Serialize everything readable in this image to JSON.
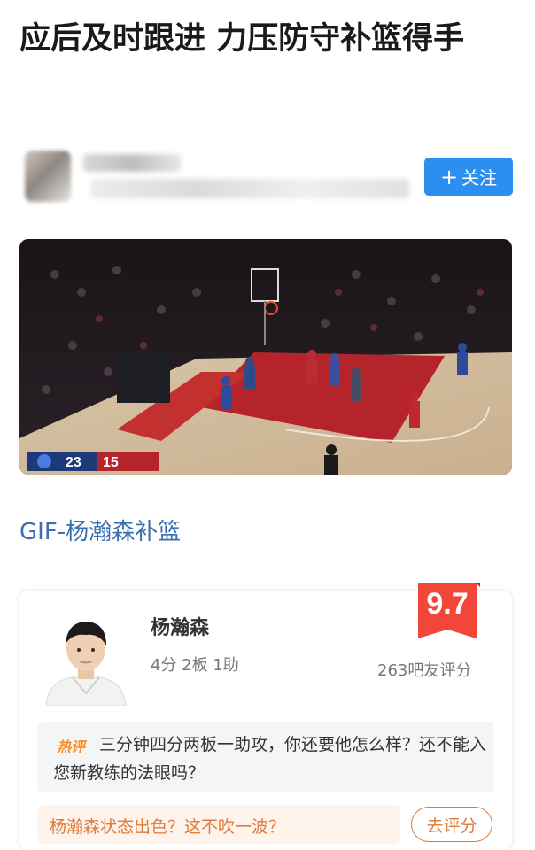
{
  "article": {
    "title": "应后及时跟进 力压防守补篮得手",
    "follow_label": "关注",
    "follow_icon": "plus-icon",
    "video": {
      "scoreboard_left": "23",
      "scoreboard_right": "15"
    },
    "caption": "GIF-杨瀚森补篮"
  },
  "player_card": {
    "name": "杨瀚森",
    "stats": "4分 2板 1助",
    "score": "9.7",
    "rating_count": "263吧友评分",
    "hot_tag": "热评",
    "hot_comment": "三分钟四分两板一助攻，你还要他怎么样？还不能入您新教练的法眼吗？",
    "prompt": "杨瀚森状态出色？这不吹一波？",
    "rate_button": "去评分"
  },
  "colors": {
    "accent_blue": "#2b8ff0",
    "caption_blue": "#3a6fb0",
    "badge_red": "#f0473a",
    "orange": "#e07a3a"
  }
}
